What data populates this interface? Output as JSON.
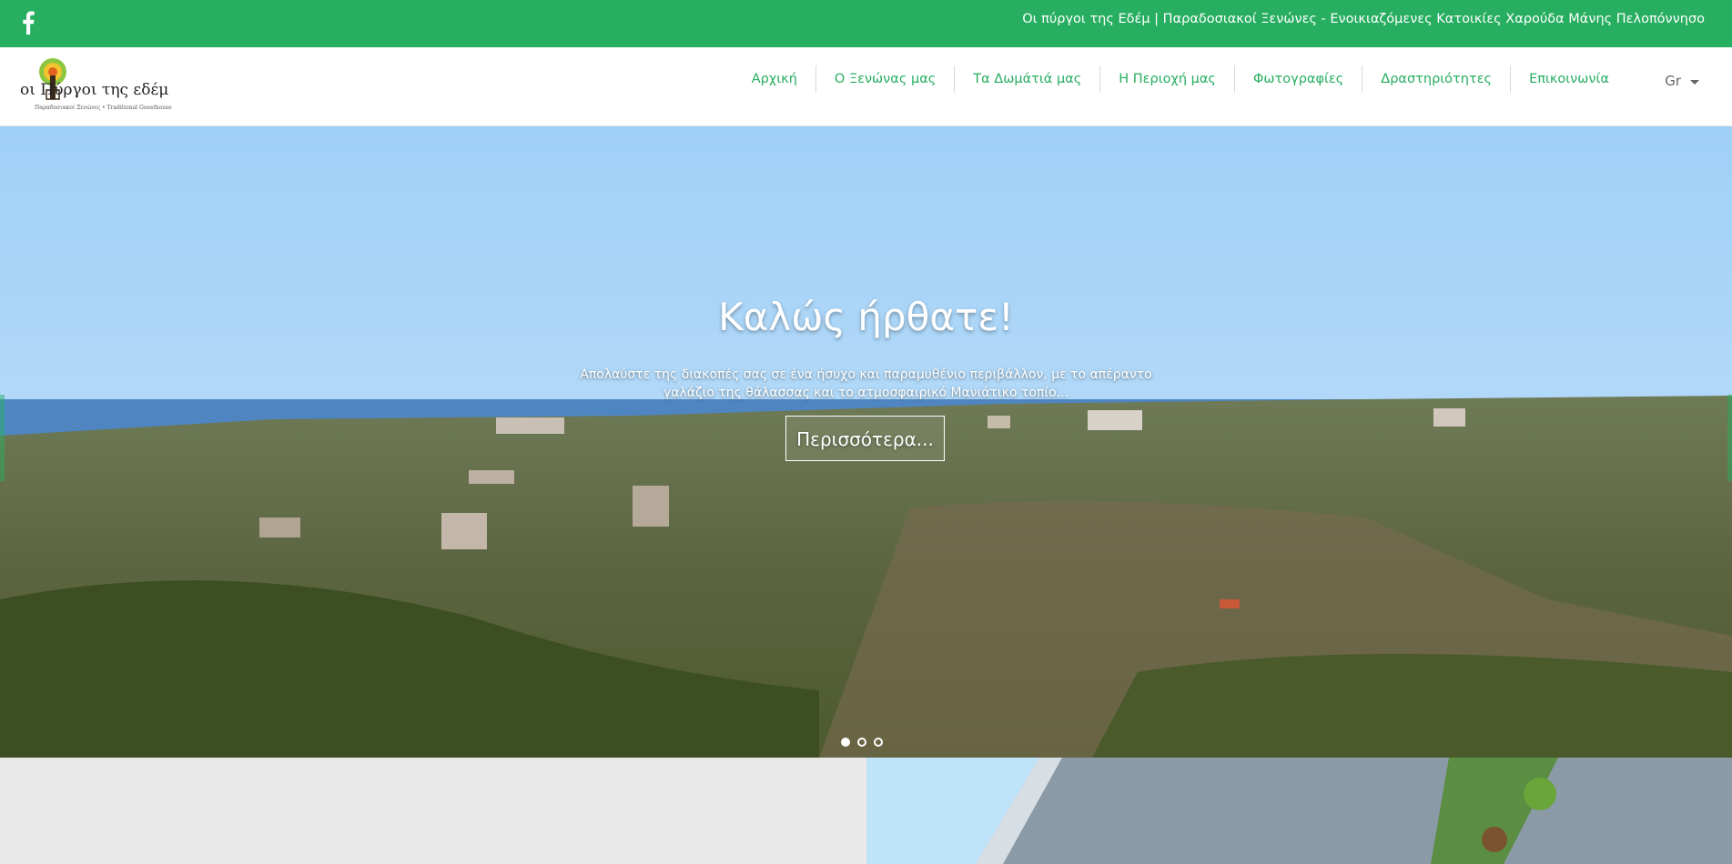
{
  "topbar": {
    "social_icon": "facebook-icon",
    "title": "Οι πύργοι της Εδέμ | Παραδοσιακοί Ξενώνες - Ενοικιαζόμενες Κατοικίες Χαρούδα Μάνης Πελοπόννησο"
  },
  "header": {
    "logo_text": "οι Πύργοι της εδέμ",
    "logo_subtitle": "Παραδοσιακοί Ξενώνες • Traditional Guesthouse",
    "nav": [
      {
        "label": "Αρχική"
      },
      {
        "label": "Ο Ξενώνας μας"
      },
      {
        "label": "Τα Δωμάτιά μας"
      },
      {
        "label": "Η Περιοχή μας"
      },
      {
        "label": "Φωτογραφίες"
      },
      {
        "label": "Δραστηριότητες"
      },
      {
        "label": "Επικοινωνία"
      }
    ],
    "language": "Gr"
  },
  "hero": {
    "title": "Καλώς ήρθατε!",
    "text": "Απολαύστε της διακοπές σας σε ένα ήσυχο και παραμυθένιο περιβάλλον, με το απέραντο γαλάζιο της θάλασσας και το ατμοσφαιρικό Μανιάτικο τοπίο...",
    "button_label": "Περισσότερα...",
    "slide_count": 3,
    "active_slide": 1
  },
  "colors": {
    "brand_green": "#27ae60",
    "sky": "#a9d4f5",
    "sea": "#4f86c2"
  }
}
